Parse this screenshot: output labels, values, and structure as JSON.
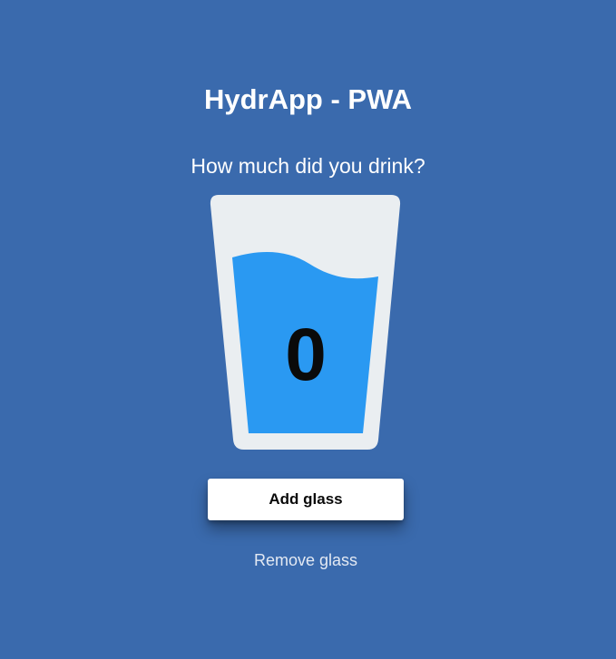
{
  "app": {
    "title": "HydrApp - PWA"
  },
  "main": {
    "question": "How much did you drink?",
    "glass_count": "0",
    "add_label": "Add glass",
    "remove_label": "Remove glass"
  },
  "colors": {
    "background": "#3a6aad",
    "glass": "#eaeef1",
    "water": "#2a99f2",
    "add_button_bg": "#ffffff"
  },
  "icons": {
    "glass": "water-glass-icon"
  }
}
